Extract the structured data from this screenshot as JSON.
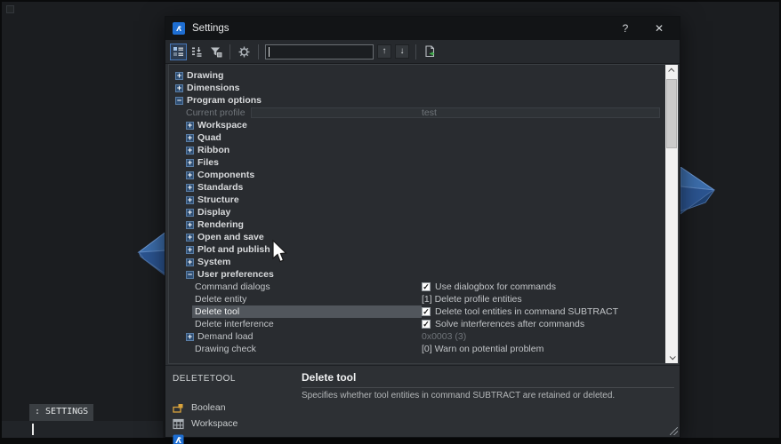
{
  "window": {
    "title": "Settings",
    "help_label": "?",
    "close_label": "✕"
  },
  "toolbar": {
    "search_value": "",
    "prev_label": "↑",
    "next_label": "↓"
  },
  "tree": {
    "rows": [
      {
        "label": "Drawing",
        "bold": true,
        "toggle": "+",
        "level": 0
      },
      {
        "label": "Dimensions",
        "bold": true,
        "toggle": "+",
        "level": 0
      },
      {
        "label": "Program options",
        "bold": true,
        "toggle": "−",
        "level": 0
      },
      {
        "label": "Current profile",
        "level": 1,
        "muted": true,
        "fieldbox": true,
        "value": "test",
        "muted_value": true
      },
      {
        "label": "Workspace",
        "bold": true,
        "toggle": "+",
        "level": 1
      },
      {
        "label": "Quad",
        "bold": true,
        "toggle": "+",
        "level": 1
      },
      {
        "label": "Ribbon",
        "bold": true,
        "toggle": "+",
        "level": 1
      },
      {
        "label": "Files",
        "bold": true,
        "toggle": "+",
        "level": 1
      },
      {
        "label": "Components",
        "bold": true,
        "toggle": "+",
        "level": 1
      },
      {
        "label": "Standards",
        "bold": true,
        "toggle": "+",
        "level": 1
      },
      {
        "label": "Structure",
        "bold": true,
        "toggle": "+",
        "level": 1
      },
      {
        "label": "Display",
        "bold": true,
        "toggle": "+",
        "level": 1
      },
      {
        "label": "Rendering",
        "bold": true,
        "toggle": "+",
        "level": 1
      },
      {
        "label": "Open and save",
        "bold": true,
        "toggle": "+",
        "level": 1
      },
      {
        "label": "Plot and publish",
        "bold": true,
        "toggle": "+",
        "level": 1
      },
      {
        "label": "System",
        "bold": true,
        "toggle": "+",
        "level": 1
      },
      {
        "label": "User preferences",
        "bold": true,
        "toggle": "−",
        "level": 1
      },
      {
        "label": "Command dialogs",
        "level": 2,
        "checkbox": true,
        "checked": true,
        "value": "Use dialogbox for commands"
      },
      {
        "label": "Delete entity",
        "level": 2,
        "value": "[1] Delete profile entities"
      },
      {
        "label": "Delete tool",
        "level": 2,
        "selected": true,
        "checkbox": true,
        "checked": true,
        "value": "Delete tool entities in command SUBTRACT"
      },
      {
        "label": "Delete interference",
        "level": 2,
        "checkbox": true,
        "checked": true,
        "value": "Solve interferences after commands"
      },
      {
        "label": "Demand load",
        "toggle": "+",
        "level": 1,
        "value": "0x0003 (3)",
        "muted_value": true
      },
      {
        "label": "Drawing check",
        "level": 2,
        "value": "[0] Warn on potential problem"
      }
    ]
  },
  "panel": {
    "variable": "DELETETOOL",
    "title": "Delete tool",
    "description": "Specifies whether tool entities in command SUBTRACT are retained or deleted.",
    "links": [
      {
        "label": "Boolean",
        "icon": "boolean-icon"
      },
      {
        "label": "Workspace",
        "icon": "workspace-icon"
      },
      {
        "label": "",
        "icon": "bricscad-icon"
      }
    ]
  },
  "command_bar": {
    "history_line": ": SETTINGS"
  },
  "colors": {
    "accent_blue": "#1e6ed2",
    "arrow_blue": "#2f5f9e",
    "arrow_blue_light": "#5b8fd4",
    "boolean_yellow": "#d9a33c",
    "export_green": "#3fae4a",
    "selection_bg": "#51565c"
  }
}
